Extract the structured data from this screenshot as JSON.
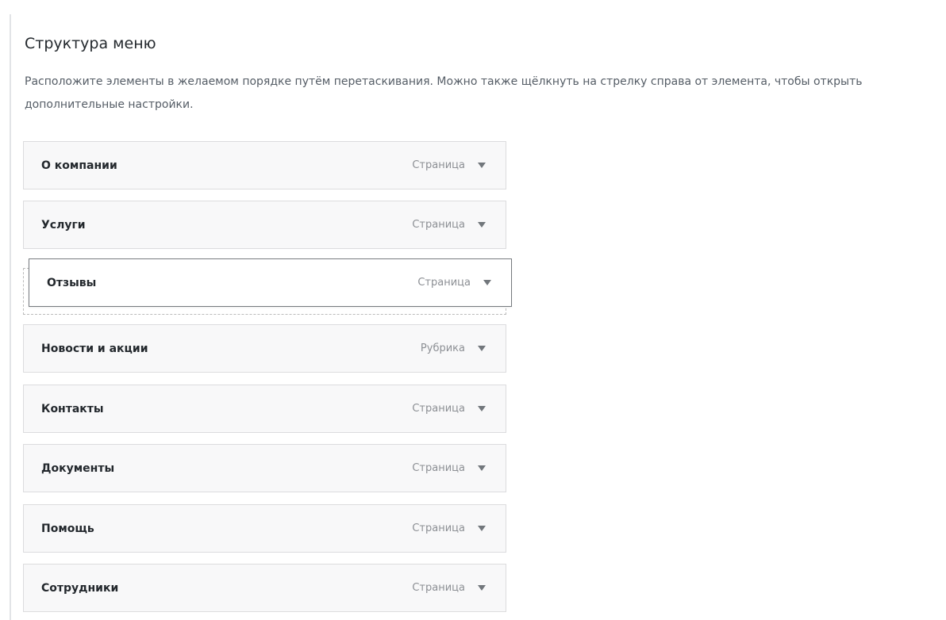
{
  "header": {
    "title": "Структура меню",
    "description": "Расположите элементы в желаемом порядке путём перетаскивания. Можно также щёлкнуть на стрелку справа от элемента, чтобы открыть дополнительные настройки."
  },
  "menu_items": [
    {
      "title": "О компании",
      "type": "Страница"
    },
    {
      "title": "Услуги",
      "type": "Страница"
    },
    {
      "title": "Отзывы",
      "type": "Страница",
      "state": "dragging"
    },
    {
      "title": "Новости и акции",
      "type": "Рубрика"
    },
    {
      "title": "Контакты",
      "type": "Страница"
    },
    {
      "title": "Документы",
      "type": "Страница"
    },
    {
      "title": "Помощь",
      "type": "Страница"
    },
    {
      "title": "Сотрудники",
      "type": "Страница"
    }
  ],
  "icons": {
    "toggle": "triangle-down-icon"
  },
  "colors": {
    "text": "#23282d",
    "muted_text": "#8c8f94",
    "item_background": "#f8f8f9",
    "item_border": "#dcdcde",
    "placeholder_border": "#bbbbbb"
  }
}
